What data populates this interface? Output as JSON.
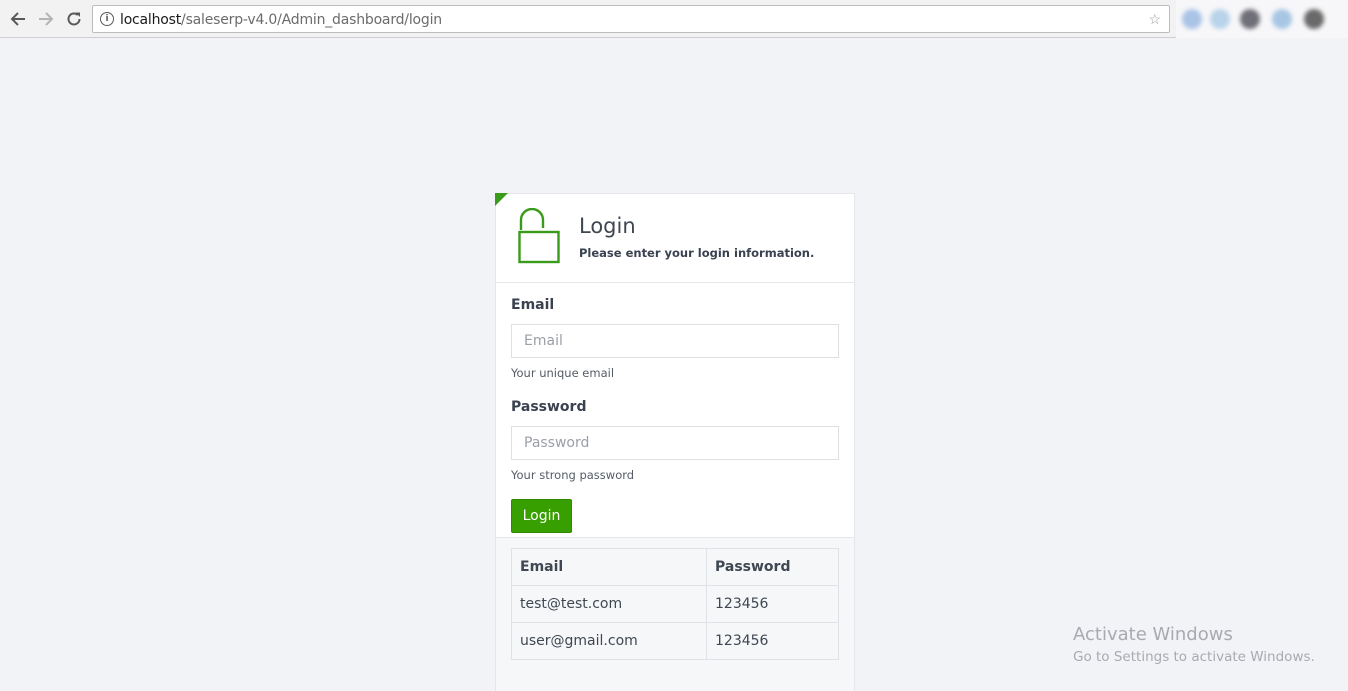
{
  "browser": {
    "url_host": "localhost",
    "url_path": "/saleserp-v4.0/Admin_dashboard/login"
  },
  "login": {
    "title": "Login",
    "subtitle": "Please enter your login information.",
    "email_label": "Email",
    "email_placeholder": "Email",
    "email_help": "Your unique email",
    "password_label": "Password",
    "password_placeholder": "Password",
    "password_help": "Your strong password",
    "submit_label": "Login",
    "accent_color": "#37a000"
  },
  "credentials": {
    "headers": [
      "Email",
      "Password"
    ],
    "rows": [
      [
        "test@test.com",
        "123456"
      ],
      [
        "user@gmail.com",
        "123456"
      ]
    ]
  },
  "watermark": {
    "title": "Activate Windows",
    "subtitle": "Go to Settings to activate Windows."
  }
}
